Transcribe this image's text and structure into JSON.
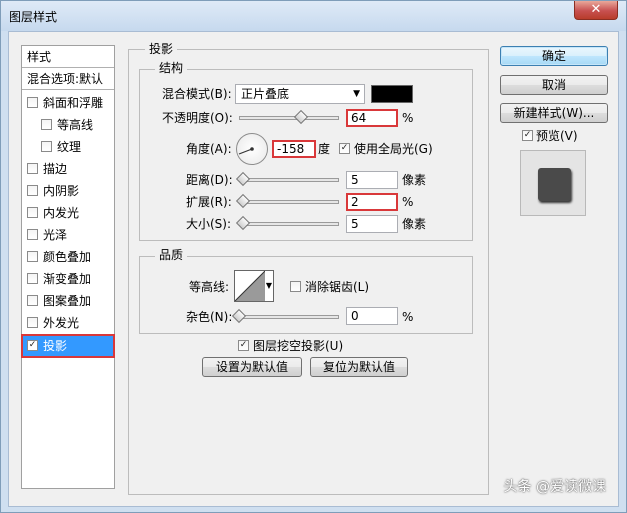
{
  "window": {
    "title": "图层样式",
    "close_glyph": "✕"
  },
  "style_list": {
    "header": "样式",
    "blend_default": "混合选项:默认",
    "items": [
      {
        "label": "斜面和浮雕",
        "checked": false
      },
      {
        "label": "等高线",
        "checked": false
      },
      {
        "label": "纹理",
        "checked": false
      },
      {
        "label": "描边",
        "checked": false
      },
      {
        "label": "内阴影",
        "checked": false
      },
      {
        "label": "内发光",
        "checked": false
      },
      {
        "label": "光泽",
        "checked": false
      },
      {
        "label": "颜色叠加",
        "checked": false
      },
      {
        "label": "渐变叠加",
        "checked": false
      },
      {
        "label": "图案叠加",
        "checked": false
      },
      {
        "label": "外发光",
        "checked": false
      },
      {
        "label": "投影",
        "checked": true,
        "selected": true
      }
    ]
  },
  "drop_shadow": {
    "title": "投影",
    "structure": {
      "title": "结构",
      "blend_mode_label": "混合模式(B):",
      "blend_mode_value": "正片叠底",
      "shadow_color": "#000000",
      "opacity_label": "不透明度(O):",
      "opacity_value": "64",
      "opacity_unit": "%",
      "angle_label": "角度(A):",
      "angle_value": "-158",
      "angle_unit": "度",
      "global_light_label": "使用全局光(G)",
      "global_light_checked": true,
      "distance_label": "距离(D):",
      "distance_value": "5",
      "distance_unit": "像素",
      "spread_label": "扩展(R):",
      "spread_value": "2",
      "spread_unit": "%",
      "size_label": "大小(S):",
      "size_value": "5",
      "size_unit": "像素"
    },
    "quality": {
      "title": "品质",
      "contour_label": "等高线:",
      "anti_alias_label": "消除锯齿(L)",
      "anti_alias_checked": false,
      "noise_label": "杂色(N):",
      "noise_value": "0",
      "noise_unit": "%"
    },
    "knockout_label": "图层挖空投影(U)",
    "knockout_checked": true,
    "make_default": "设置为默认值",
    "reset_default": "复位为默认值"
  },
  "buttons": {
    "ok": "确定",
    "cancel": "取消",
    "new_style": "新建样式(W)...",
    "preview_label": "预览(V)",
    "preview_checked": true
  },
  "watermark": "头条 @爱读微课",
  "colors": {
    "selection": "#3399ff",
    "highlight_border": "#d9383a"
  }
}
